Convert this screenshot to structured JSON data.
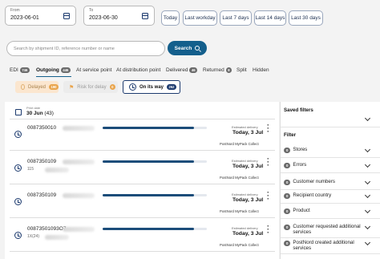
{
  "date_range": {
    "from": {
      "label": "From",
      "value": "2023-06-01"
    },
    "to": {
      "label": "To",
      "value": "2023-06-30"
    }
  },
  "quick_dates": [
    "Today",
    "Last workday",
    "Last 7 days",
    "Last 14 days",
    "Last 30 days"
  ],
  "search": {
    "placeholder": "Search by shipment ID, reference number or name",
    "button_label": "Search"
  },
  "tabs": [
    {
      "label": "EDI",
      "count": "746"
    },
    {
      "label": "Outgoing",
      "count": "446"
    },
    {
      "label": "At service point",
      "count": ""
    },
    {
      "label": "At distribution point",
      "count": ""
    },
    {
      "label": "Delivered",
      "count": "46"
    },
    {
      "label": "Returned",
      "count": "8"
    },
    {
      "label": "Split",
      "count": ""
    },
    {
      "label": "Hidden",
      "count": ""
    }
  ],
  "status_filters": [
    {
      "label": "Delayed",
      "count": "190"
    },
    {
      "label": "Risk for delay",
      "count": "0"
    },
    {
      "label": "On its way",
      "count": "252"
    }
  ],
  "group": {
    "caption": "Print date",
    "date": "30 Jun",
    "count": "(43)"
  },
  "shipments": [
    {
      "id": "0087350010",
      "ref": "",
      "progress": 0.88,
      "est_label": "Estimated delivery",
      "est_value": "Today, 3 Jul",
      "service": "PostNord MyPack Collect"
    },
    {
      "id": "0087350109",
      "ref": "115",
      "progress": 0.88,
      "est_label": "Estimated delivery",
      "est_value": "Today, 3 Jul",
      "service": "PostNord MyPack Collect"
    },
    {
      "id": "0087350109",
      "ref": "",
      "progress": 0.88,
      "est_label": "Estimated delivery",
      "est_value": "Today, 3 Jul",
      "service": "PostNord MyPack Collect"
    },
    {
      "id": "00873501093O7",
      "ref": "1X(24)",
      "progress": 0.88,
      "est_label": "Estimated delivery",
      "est_value": "Today, 3 Jul",
      "service": "PostNord MyPack Collect"
    }
  ],
  "sidebar": {
    "saved_filters_title": "Saved filters",
    "filter_title": "Filter",
    "filters": [
      {
        "count": "0",
        "label": "Stores"
      },
      {
        "count": "0",
        "label": "Errors"
      },
      {
        "count": "0",
        "label": "Customer numbers"
      },
      {
        "count": "0",
        "label": "Recipient country"
      },
      {
        "count": "0",
        "label": "Product"
      },
      {
        "count": "0",
        "label": "Customer requested additional services"
      },
      {
        "count": "0",
        "label": "PostNord created additional services"
      }
    ]
  },
  "colors": {
    "accent": "#145f8c",
    "navy": "#1c3a6e",
    "delayed_bg": "#fbe6cf",
    "risk_bg": "#f3f3f3"
  }
}
